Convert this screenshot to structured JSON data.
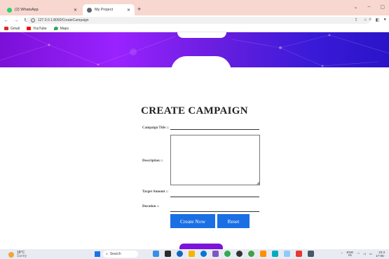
{
  "browser": {
    "tabs": [
      {
        "label": "(2) WhatsApp",
        "favicon_color": "#25d366"
      },
      {
        "label": "My Project",
        "favicon_color": "#5f6368"
      }
    ],
    "new_tab_label": "+",
    "address": "127.0.0.1:8000/CreateCampaign",
    "bookmarks": [
      {
        "label": "Gmail",
        "icon_color": "#d93025"
      },
      {
        "label": "YouTube",
        "icon_color": "#ff0000"
      },
      {
        "label": "Maps",
        "icon_color": "#34a853"
      }
    ]
  },
  "form": {
    "title": "CREATE CAMPAIGN",
    "fields": {
      "campaign_title_label": "Campaign Title ::",
      "description_label": "Description ::",
      "target_amount_label": "Target Amount ::",
      "duration_label": "Duration ::"
    },
    "buttons": {
      "create_label": "Create Now",
      "reset_label": "Reset"
    },
    "accent_color": "#1b6fe4",
    "banner_colors": [
      "#7b10d8",
      "#2a14c8"
    ]
  },
  "taskbar": {
    "weather_temp": "18°C",
    "weather_text": "Sunny",
    "search_placeholder": "Search",
    "lang_top": "ENG",
    "lang_bottom": "IN",
    "time": "22:3",
    "date": "17-05-"
  }
}
